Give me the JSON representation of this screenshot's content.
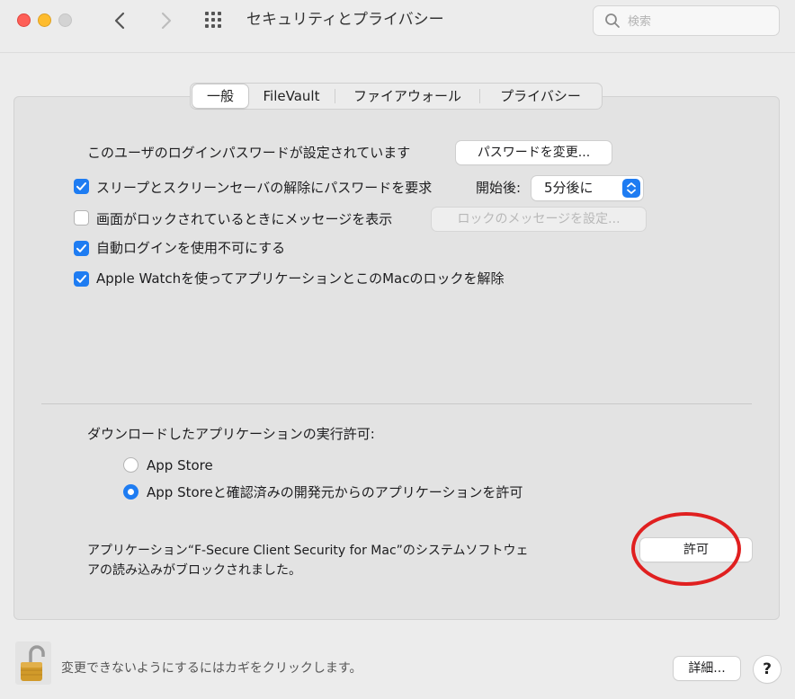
{
  "window": {
    "title": "セキュリティとプライバシー",
    "search_placeholder": "検索"
  },
  "tabs": [
    {
      "label": "一般",
      "active": true
    },
    {
      "label": "FileVault",
      "active": false
    },
    {
      "label": "ファイアウォール",
      "active": false
    },
    {
      "label": "プライバシー",
      "active": false
    }
  ],
  "general": {
    "password_set_text": "このユーザのログインパスワードが設定されています",
    "change_password_button": "パスワードを変更...",
    "require_password": {
      "label": "スリープとスクリーンセーバの解除にパスワードを要求",
      "checked": true
    },
    "after_label": "開始後:",
    "after_value": "5分後に",
    "lock_message": {
      "label": "画面がロックされているときにメッセージを表示",
      "checked": false
    },
    "lock_message_button": "ロックのメッセージを設定...",
    "disable_auto_login": {
      "label": "自動ログインを使用不可にする",
      "checked": true
    },
    "apple_watch": {
      "label": "Apple Watchを使ってアプリケーションとこのMacのロックを解除",
      "checked": true
    }
  },
  "downloads": {
    "heading": "ダウンロードしたアプリケーションの実行許可:",
    "options": [
      {
        "label": "App Store",
        "selected": false
      },
      {
        "label": "App Storeと確認済みの開発元からのアプリケーションを許可",
        "selected": true
      }
    ]
  },
  "blocked": {
    "line1": "アプリケーション“F-Secure Client Security for Mac”のシステムソフトウェ",
    "line2": "アの読み込みがブロックされました。",
    "allow_button": "許可"
  },
  "footer": {
    "lock_text": "変更できないようにするにはカギをクリックします。",
    "advanced_button": "詳細...",
    "help_button": "?"
  },
  "colors": {
    "accent": "#1e7cf2",
    "annotation": "#e02020"
  }
}
